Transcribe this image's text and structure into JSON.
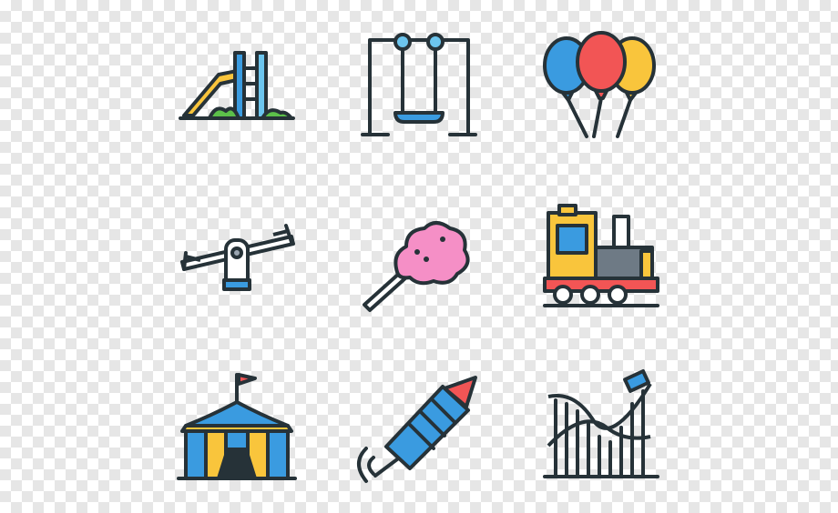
{
  "icons": [
    {
      "name": "slide-icon"
    },
    {
      "name": "swing-icon"
    },
    {
      "name": "balloons-icon"
    },
    {
      "name": "seesaw-icon"
    },
    {
      "name": "cotton-candy-icon"
    },
    {
      "name": "toy-train-icon"
    },
    {
      "name": "circus-tent-icon"
    },
    {
      "name": "firework-rocket-icon"
    },
    {
      "name": "roller-coaster-icon"
    }
  ],
  "colors": {
    "outline": "#263238",
    "yellow": "#f9c53c",
    "blue": "#3a9be0",
    "light-blue": "#6cc5ee",
    "red": "#f25555",
    "pink": "#f58fc6",
    "green": "#5cc04a",
    "grey": "#9aa5b1"
  }
}
